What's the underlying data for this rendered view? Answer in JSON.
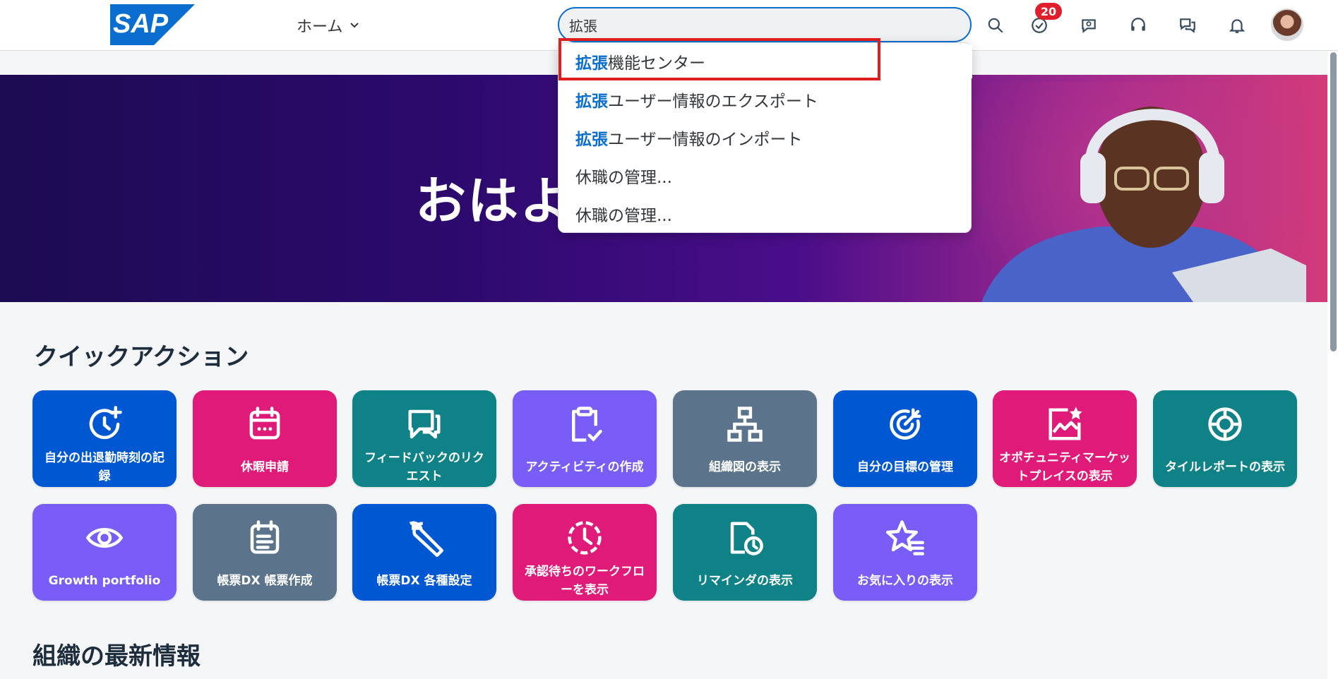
{
  "header": {
    "logo_text": "SAP",
    "home_label": "ホーム",
    "search_value": "拡張",
    "notification_count": "20"
  },
  "search_suggestions": [
    {
      "match": "拡張",
      "rest": "機能センター"
    },
    {
      "match": "拡張",
      "rest": "ユーザー情報のエクスポート"
    },
    {
      "match": "拡張",
      "rest": "ユーザー情報のインポート"
    },
    {
      "match": "",
      "rest": "休職の管理..."
    },
    {
      "match": "",
      "rest": "休職の管理..."
    }
  ],
  "hero": {
    "greeting": "おはよ"
  },
  "quick_actions": {
    "title": "クイックアクション",
    "tiles": [
      {
        "label": "自分の出退勤時刻の記録",
        "icon": "clock-plus-icon",
        "color": "#0057d2"
      },
      {
        "label": "休暇申請",
        "icon": "calendar-icon",
        "color": "#e01a78"
      },
      {
        "label": "フィードバックのリクエスト",
        "icon": "feedback-icon",
        "color": "#0f8287"
      },
      {
        "label": "アクティビティの作成",
        "icon": "clipboard-check-icon",
        "color": "#7a5cf6"
      },
      {
        "label": "組織図の表示",
        "icon": "org-chart-icon",
        "color": "#5b738b"
      },
      {
        "label": "自分の目標の管理",
        "icon": "target-icon",
        "color": "#0057d2"
      },
      {
        "label": "オポチュニティマーケットプレイスの表示",
        "icon": "chart-star-icon",
        "color": "#e01a78"
      },
      {
        "label": "タイルレポートの表示",
        "icon": "report-icon",
        "color": "#0f8287"
      },
      {
        "label": "Growth portfolio",
        "icon": "eye-icon",
        "color": "#7a5cf6"
      },
      {
        "label": "帳票DX 帳票作成",
        "icon": "form-icon",
        "color": "#5b738b"
      },
      {
        "label": "帳票DX 各種設定",
        "icon": "wrench-icon",
        "color": "#0057d2"
      },
      {
        "label": "承認待ちのワークフローを表示",
        "icon": "pending-clock-icon",
        "color": "#e01a78"
      },
      {
        "label": "リマインダの表示",
        "icon": "document-clock-icon",
        "color": "#0f8287"
      },
      {
        "label": "お気に入りの表示",
        "icon": "star-list-icon",
        "color": "#7a5cf6"
      }
    ]
  },
  "news": {
    "title": "組織の最新情報"
  },
  "colors": {
    "accent": "#0a6ed1",
    "highlight_box": "#e01e1e",
    "badge": "#e01e2c"
  }
}
